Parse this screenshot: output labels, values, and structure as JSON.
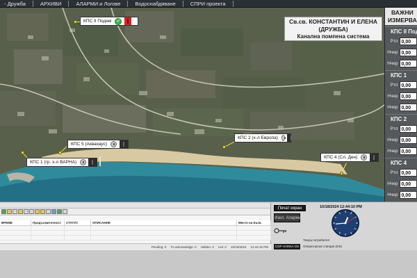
{
  "menu": {
    "items": [
      "- Дружба",
      "АРХИВИ",
      "АЛАРМИ и Логове",
      "Водоснабдяване",
      "СПРИ проекта"
    ]
  },
  "title_card": {
    "line1": "Св.св. КОНСТАНТИН И ЕЛЕНА",
    "line2": "(ДРУЖБА)",
    "line3": "Канална помпена система"
  },
  "stations": {
    "kps2_podem": {
      "label": "КПС II Подем",
      "status_icon": "check-icon",
      "colors": {
        "ok": "#3db84a",
        "alarm": "#d91f1f"
      }
    },
    "kps5": {
      "label": "КПС 5 (Аквахаус)"
    },
    "kps1": {
      "label": "КПС 1 (гр. х-л ВАРНА)"
    },
    "kps2": {
      "label": "КПС 2 (х-л Европа)"
    },
    "kps4": {
      "label": "КПС 4 (Сл. Ден)"
    }
  },
  "right_panel": {
    "header_line1": "ВАЖНИ",
    "header_line2": "ИЗМЕРВА",
    "sections": [
      {
        "title": "КПС II Подем",
        "rows": [
          {
            "k": "Ртл",
            "v": "0,00"
          },
          {
            "k": "Нчер",
            "v": "0,00"
          },
          {
            "k": "Нчер",
            "v": "0,00"
          }
        ]
      },
      {
        "title": "КПС 1",
        "rows": [
          {
            "k": "Ртл",
            "v": "0,00"
          },
          {
            "k": "Нчер",
            "v": "0,00"
          },
          {
            "k": "Нчер",
            "v": "0,00"
          }
        ]
      },
      {
        "title": "КПС 2",
        "rows": [
          {
            "k": "Ртл",
            "v": "0,00"
          },
          {
            "k": "Нчер",
            "v": "0,00"
          },
          {
            "k": "Нчер",
            "v": "0,00"
          }
        ]
      },
      {
        "title": "КПС 4",
        "rows": [
          {
            "k": "Ртл",
            "v": "0,00"
          },
          {
            "k": "Нчер",
            "v": "0,00"
          },
          {
            "k": "Нчер",
            "v": "0,00"
          }
        ]
      }
    ]
  },
  "alarm_window": {
    "columns": [
      "ВРЕМЕ",
      "Продължителност",
      "СТАТУС",
      "ОПИСАНИЕ",
      "Място на възн."
    ],
    "status_items": [
      "Pending: 0",
      "To acknowledge: 0",
      "Hidden: 0",
      "List: 0",
      "10/18/2024",
      "12:44:10 PM"
    ]
  },
  "control_panel": {
    "print_label": "Печат екран",
    "alarm_off_label": "Изкл. Аларми",
    "key_label": "Текущ потребител",
    "workstation_label": "Операторска станция (OS)",
    "workstation_tag": "COP-VARNA-OS",
    "datetime": "10/18/2024 12:44:10 PM"
  },
  "clock": {
    "hour": 12,
    "minute": 44,
    "second": 10
  }
}
